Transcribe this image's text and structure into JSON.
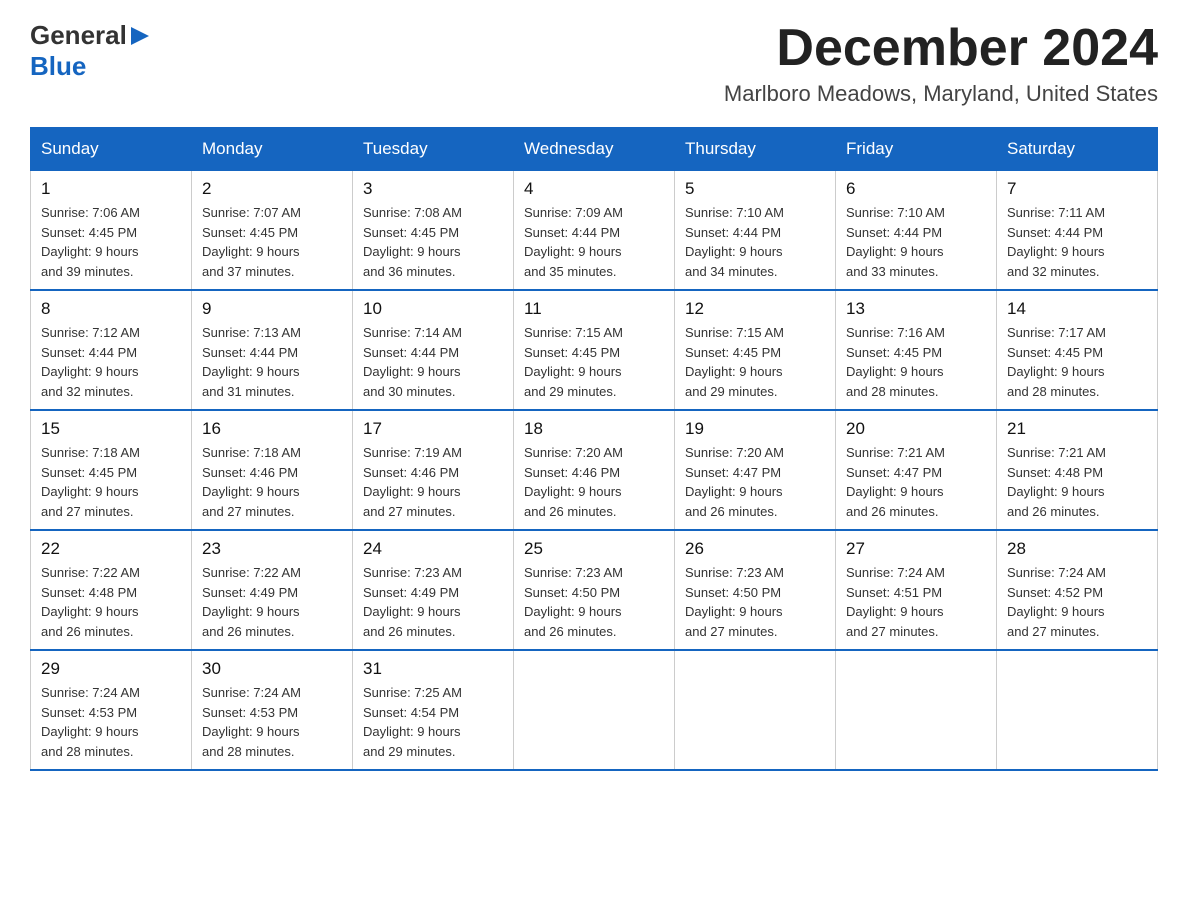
{
  "header": {
    "logo_general": "General",
    "logo_blue": "Blue",
    "month_title": "December 2024",
    "location": "Marlboro Meadows, Maryland, United States"
  },
  "days_of_week": [
    "Sunday",
    "Monday",
    "Tuesday",
    "Wednesday",
    "Thursday",
    "Friday",
    "Saturday"
  ],
  "weeks": [
    [
      {
        "day": "1",
        "sunrise": "7:06 AM",
        "sunset": "4:45 PM",
        "daylight": "9 hours and 39 minutes."
      },
      {
        "day": "2",
        "sunrise": "7:07 AM",
        "sunset": "4:45 PM",
        "daylight": "9 hours and 37 minutes."
      },
      {
        "day": "3",
        "sunrise": "7:08 AM",
        "sunset": "4:45 PM",
        "daylight": "9 hours and 36 minutes."
      },
      {
        "day": "4",
        "sunrise": "7:09 AM",
        "sunset": "4:44 PM",
        "daylight": "9 hours and 35 minutes."
      },
      {
        "day": "5",
        "sunrise": "7:10 AM",
        "sunset": "4:44 PM",
        "daylight": "9 hours and 34 minutes."
      },
      {
        "day": "6",
        "sunrise": "7:10 AM",
        "sunset": "4:44 PM",
        "daylight": "9 hours and 33 minutes."
      },
      {
        "day": "7",
        "sunrise": "7:11 AM",
        "sunset": "4:44 PM",
        "daylight": "9 hours and 32 minutes."
      }
    ],
    [
      {
        "day": "8",
        "sunrise": "7:12 AM",
        "sunset": "4:44 PM",
        "daylight": "9 hours and 32 minutes."
      },
      {
        "day": "9",
        "sunrise": "7:13 AM",
        "sunset": "4:44 PM",
        "daylight": "9 hours and 31 minutes."
      },
      {
        "day": "10",
        "sunrise": "7:14 AM",
        "sunset": "4:44 PM",
        "daylight": "9 hours and 30 minutes."
      },
      {
        "day": "11",
        "sunrise": "7:15 AM",
        "sunset": "4:45 PM",
        "daylight": "9 hours and 29 minutes."
      },
      {
        "day": "12",
        "sunrise": "7:15 AM",
        "sunset": "4:45 PM",
        "daylight": "9 hours and 29 minutes."
      },
      {
        "day": "13",
        "sunrise": "7:16 AM",
        "sunset": "4:45 PM",
        "daylight": "9 hours and 28 minutes."
      },
      {
        "day": "14",
        "sunrise": "7:17 AM",
        "sunset": "4:45 PM",
        "daylight": "9 hours and 28 minutes."
      }
    ],
    [
      {
        "day": "15",
        "sunrise": "7:18 AM",
        "sunset": "4:45 PM",
        "daylight": "9 hours and 27 minutes."
      },
      {
        "day": "16",
        "sunrise": "7:18 AM",
        "sunset": "4:46 PM",
        "daylight": "9 hours and 27 minutes."
      },
      {
        "day": "17",
        "sunrise": "7:19 AM",
        "sunset": "4:46 PM",
        "daylight": "9 hours and 27 minutes."
      },
      {
        "day": "18",
        "sunrise": "7:20 AM",
        "sunset": "4:46 PM",
        "daylight": "9 hours and 26 minutes."
      },
      {
        "day": "19",
        "sunrise": "7:20 AM",
        "sunset": "4:47 PM",
        "daylight": "9 hours and 26 minutes."
      },
      {
        "day": "20",
        "sunrise": "7:21 AM",
        "sunset": "4:47 PM",
        "daylight": "9 hours and 26 minutes."
      },
      {
        "day": "21",
        "sunrise": "7:21 AM",
        "sunset": "4:48 PM",
        "daylight": "9 hours and 26 minutes."
      }
    ],
    [
      {
        "day": "22",
        "sunrise": "7:22 AM",
        "sunset": "4:48 PM",
        "daylight": "9 hours and 26 minutes."
      },
      {
        "day": "23",
        "sunrise": "7:22 AM",
        "sunset": "4:49 PM",
        "daylight": "9 hours and 26 minutes."
      },
      {
        "day": "24",
        "sunrise": "7:23 AM",
        "sunset": "4:49 PM",
        "daylight": "9 hours and 26 minutes."
      },
      {
        "day": "25",
        "sunrise": "7:23 AM",
        "sunset": "4:50 PM",
        "daylight": "9 hours and 26 minutes."
      },
      {
        "day": "26",
        "sunrise": "7:23 AM",
        "sunset": "4:50 PM",
        "daylight": "9 hours and 27 minutes."
      },
      {
        "day": "27",
        "sunrise": "7:24 AM",
        "sunset": "4:51 PM",
        "daylight": "9 hours and 27 minutes."
      },
      {
        "day": "28",
        "sunrise": "7:24 AM",
        "sunset": "4:52 PM",
        "daylight": "9 hours and 27 minutes."
      }
    ],
    [
      {
        "day": "29",
        "sunrise": "7:24 AM",
        "sunset": "4:53 PM",
        "daylight": "9 hours and 28 minutes."
      },
      {
        "day": "30",
        "sunrise": "7:24 AM",
        "sunset": "4:53 PM",
        "daylight": "9 hours and 28 minutes."
      },
      {
        "day": "31",
        "sunrise": "7:25 AM",
        "sunset": "4:54 PM",
        "daylight": "9 hours and 29 minutes."
      },
      null,
      null,
      null,
      null
    ]
  ],
  "sunrise_label": "Sunrise: ",
  "sunset_label": "Sunset: ",
  "daylight_label": "Daylight: "
}
